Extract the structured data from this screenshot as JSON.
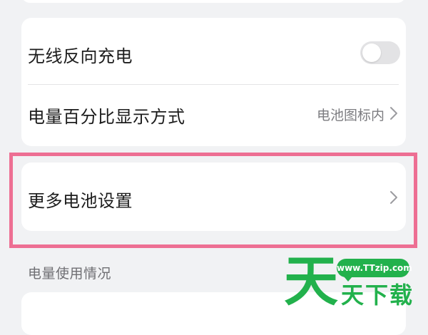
{
  "settings": {
    "wireless_reverse_charging": {
      "label": "无线反向充电",
      "enabled": false
    },
    "battery_percentage_display": {
      "label": "电量百分比显示方式",
      "value": "电池图标内"
    },
    "more_battery_settings": {
      "label": "更多电池设置"
    }
  },
  "section": {
    "usage_header": "电量使用情况"
  },
  "colors": {
    "background": "#f1f2f4",
    "card": "#ffffff",
    "highlight_frame": "#ed6f93",
    "toggle_off": "#e3e3e5",
    "watermark_green": "#22b14c"
  },
  "watermark": {
    "url": "www.TTzip.com",
    "big_char": "天",
    "small_text": "天下载"
  }
}
